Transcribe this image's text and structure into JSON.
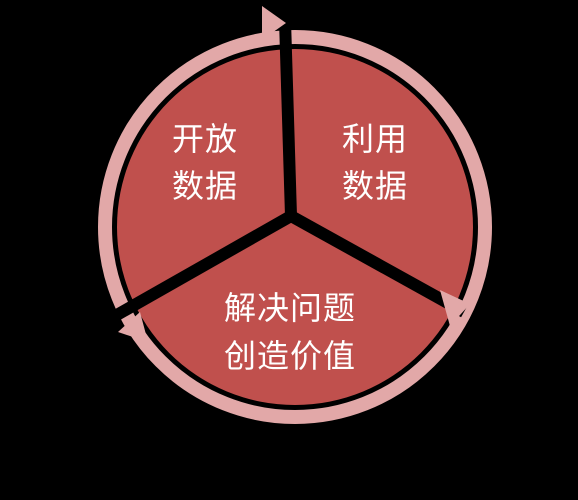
{
  "diagram": {
    "segments": [
      {
        "id": "open-data",
        "lines": [
          "开放",
          "数据"
        ]
      },
      {
        "id": "use-data",
        "lines": [
          "利用",
          "数据"
        ]
      },
      {
        "id": "solve-problems-create-value",
        "lines": [
          "解决问题",
          "创造价值"
        ]
      }
    ]
  },
  "colors": {
    "background": "#000000",
    "segment_fill": "#c0504d",
    "ring_arrow": "#e2a8a8",
    "divider": "#000000",
    "text": "#ffffff"
  }
}
